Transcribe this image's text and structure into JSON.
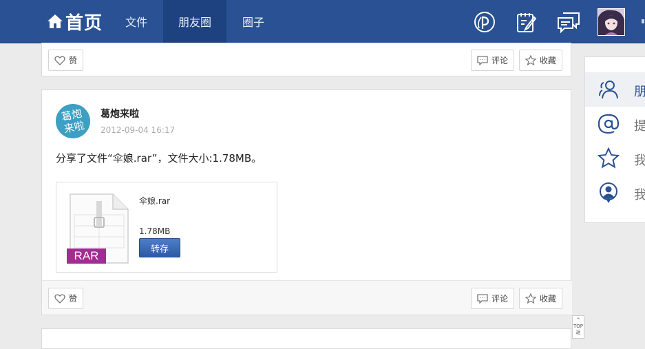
{
  "header": {
    "home_label": "首页",
    "tabs": [
      {
        "label": "文件",
        "active": false
      },
      {
        "label": "朋友圈",
        "active": true
      },
      {
        "label": "圈子",
        "active": false
      }
    ],
    "tools": [
      "music-icon",
      "edit-icon",
      "message-icon"
    ],
    "bg_color": "#2a5193"
  },
  "actions": {
    "like": "赞",
    "comment": "评论",
    "favorite": "收藏"
  },
  "post": {
    "avatar_text": [
      "葛炮",
      "来啦"
    ],
    "author": "葛炮来啦",
    "time": "2012-09-04 16:17",
    "text": "分享了文件“伞娘.rar”，文件大小:1.78MB。",
    "file": {
      "name": "伞娘.rar",
      "size": "1.78MB",
      "type_badge": "RAR",
      "save_label": "转存"
    }
  },
  "sidebar": {
    "items": [
      {
        "label": "朋",
        "icon": "friends-icon",
        "active": true
      },
      {
        "label": "提",
        "icon": "at-icon",
        "active": false
      },
      {
        "label": "我",
        "icon": "star-icon",
        "active": false
      },
      {
        "label": "我",
        "icon": "user-circle-icon",
        "active": false
      }
    ]
  },
  "back_to_top": {
    "line1": "TOP",
    "line2": "返"
  }
}
